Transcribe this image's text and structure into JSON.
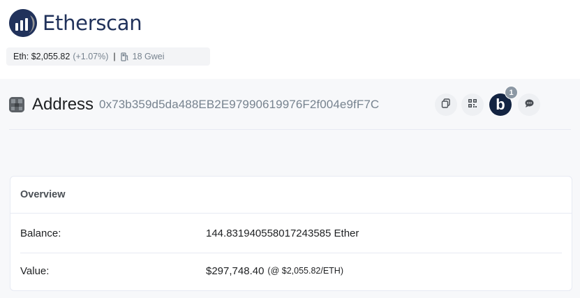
{
  "header": {
    "logo_text": "Etherscan",
    "price": {
      "label": "Eth: $2,055.82",
      "change": "(+1.07%)",
      "separator": "|",
      "gas": "18 Gwei",
      "gas_icon": "gas-pump-icon"
    }
  },
  "address": {
    "title": "Address",
    "hash": "0x73b359d5da488EB2E97990619976F2f004e9fF7C",
    "actions": [
      {
        "name": "copy-icon"
      },
      {
        "name": "qr-code-icon"
      },
      {
        "name": "blockscan-chat-icon",
        "label": "b",
        "badge": "1"
      },
      {
        "name": "comment-icon"
      }
    ]
  },
  "overview": {
    "title": "Overview",
    "balance_label": "Balance:",
    "balance_value": "144.831940558017243585 Ether",
    "value_label": "Value:",
    "value_amount": "$297,748.40",
    "value_rate": "(@ $2,055.82/ETH)"
  },
  "colors": {
    "brand": "#21325b",
    "muted": "#77838f",
    "blockscan": "#132442"
  }
}
